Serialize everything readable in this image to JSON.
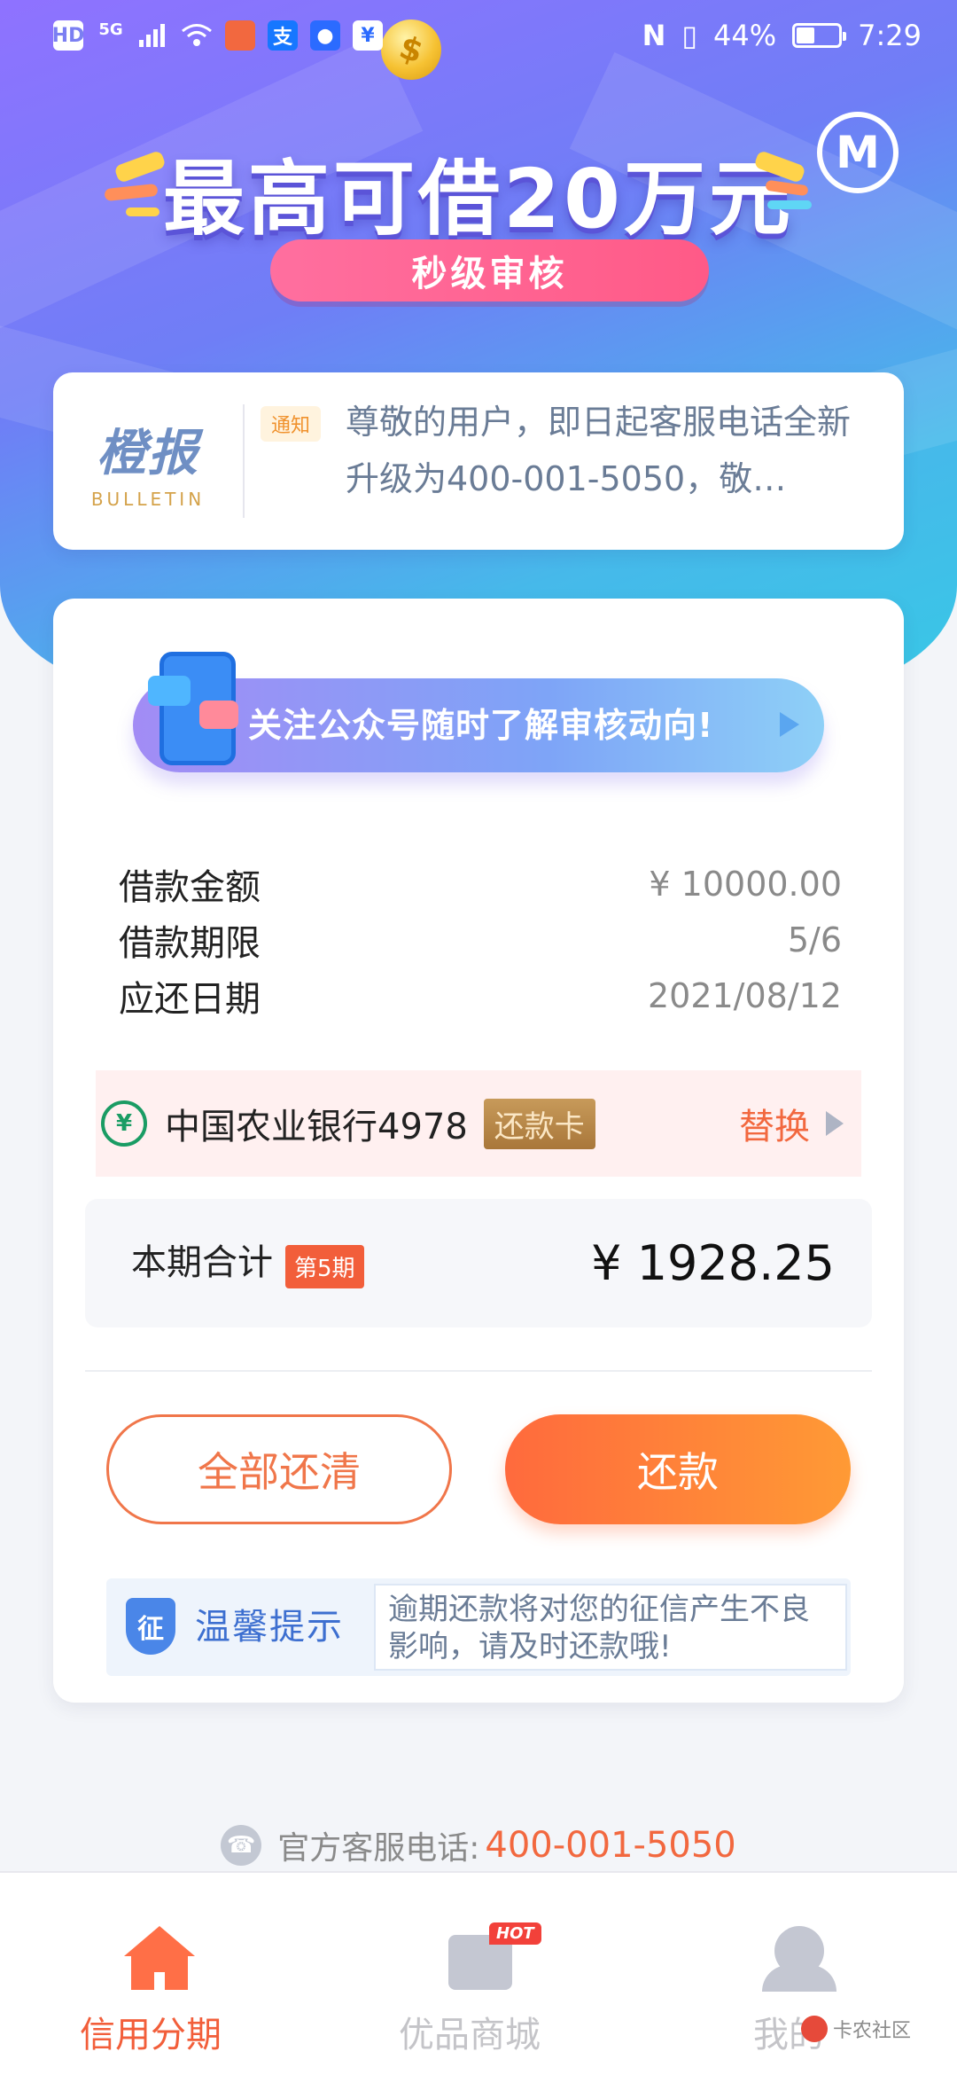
{
  "status_bar": {
    "left_icons": [
      "HD",
      "5G",
      "signal-icon",
      "wifi-icon",
      "app-icon-1",
      "alipay-icon",
      "bulb-icon",
      "app-icon-2"
    ],
    "nfc": "N",
    "battery": "44%",
    "time": "7:29"
  },
  "hero": {
    "headline": "最高可借20万元",
    "pill": "秒级审核",
    "logo": "M"
  },
  "bulletin": {
    "logo_cn": "橙报",
    "logo_en": "BULLETIN",
    "tag": "通知",
    "text": "尊敬的用户，即日起客服电话全新升级为400-001-5050，敬…"
  },
  "card": {
    "follow_banner": "关注公众号随时了解审核动向!",
    "rows": [
      {
        "label": "借款金额",
        "value": "¥ 10000.00"
      },
      {
        "label": "借款期限",
        "value": "5/6"
      },
      {
        "label": "应还日期",
        "value": "2021/08/12"
      }
    ],
    "bank": {
      "name": "中国农业银行4978",
      "card_tag": "还款卡",
      "swap": "替换"
    },
    "total": {
      "label": "本期合计",
      "period": "第5期",
      "amount": "¥ 1928.25"
    },
    "buttons": {
      "payoff": "全部还清",
      "pay": "还款"
    },
    "tip": {
      "badge": "征",
      "title": "温馨提示",
      "text": "逾期还款将对您的征信产生不良影响，请及时还款哦!"
    }
  },
  "hotline": {
    "label": "官方客服电话:",
    "number": "400-001-5050"
  },
  "tabbar": {
    "items": [
      {
        "label": "信用分期",
        "icon": "home-icon",
        "active": true
      },
      {
        "label": "优品商城",
        "icon": "shopping-bag-icon",
        "badge": "HOT",
        "active": false
      },
      {
        "label": "我的",
        "icon": "profile-icon",
        "active": false
      }
    ]
  },
  "watermark": "卡农社区",
  "colors": {
    "accent": "#f25e3a",
    "hero_start": "#8f72ff",
    "hero_end": "#38c7e6",
    "link_blue": "#3d6fd0"
  }
}
